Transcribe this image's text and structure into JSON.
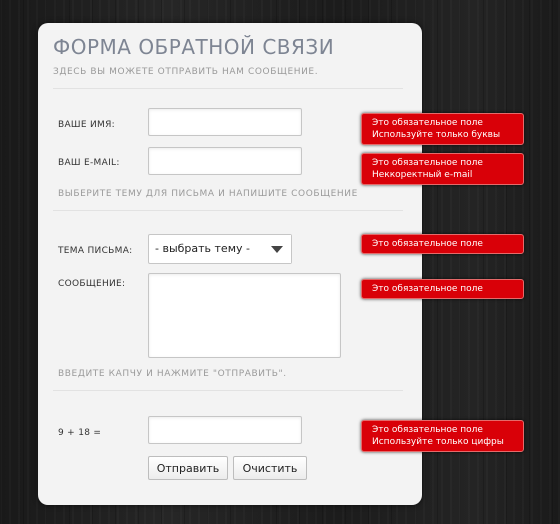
{
  "form": {
    "title": "ФОРМА ОБРАТНОЙ СВЯЗИ",
    "subtitle": "ЗДЕСЬ ВЫ МОЖЕТЕ ОТПРАВИТЬ НАМ СООБЩЕНИЕ.",
    "name_label": "ВАШЕ ИМЯ:",
    "name_value": "",
    "email_label": "ВАШ E-MAIL:",
    "email_value": "",
    "topic_hint": "ВЫБЕРИТЕ ТЕМУ ДЛЯ ПИСЬМА И НАПИШИТЕ СООБЩЕНИЕ",
    "subject_label": "ТЕМА ПИСЬМА:",
    "subject_selected": "- выбрать тему -",
    "message_label": "СООБЩЕНИЕ:",
    "message_value": "",
    "captcha_hint": "ВВЕДИТЕ КАПЧУ И НАЖМИТЕ \"ОТПРАВИТЬ\".",
    "captcha_question": "9 + 18 =",
    "captcha_value": "",
    "submit_label": "Отправить",
    "clear_label": "Очистить"
  },
  "errors": {
    "name": [
      "Это обязательное поле",
      "Используйте только буквы"
    ],
    "email": [
      "Это обязательное поле",
      "Неккоректный e-mail"
    ],
    "subject": [
      "Это обязательное поле"
    ],
    "message": [
      "Это обязательное поле"
    ],
    "captcha": [
      "Это обязательное поле",
      "Используйте только цифры"
    ]
  },
  "colors": {
    "error_bg": "#d90008",
    "panel_bg": "#f3f3f3",
    "title": "#7e8593"
  }
}
